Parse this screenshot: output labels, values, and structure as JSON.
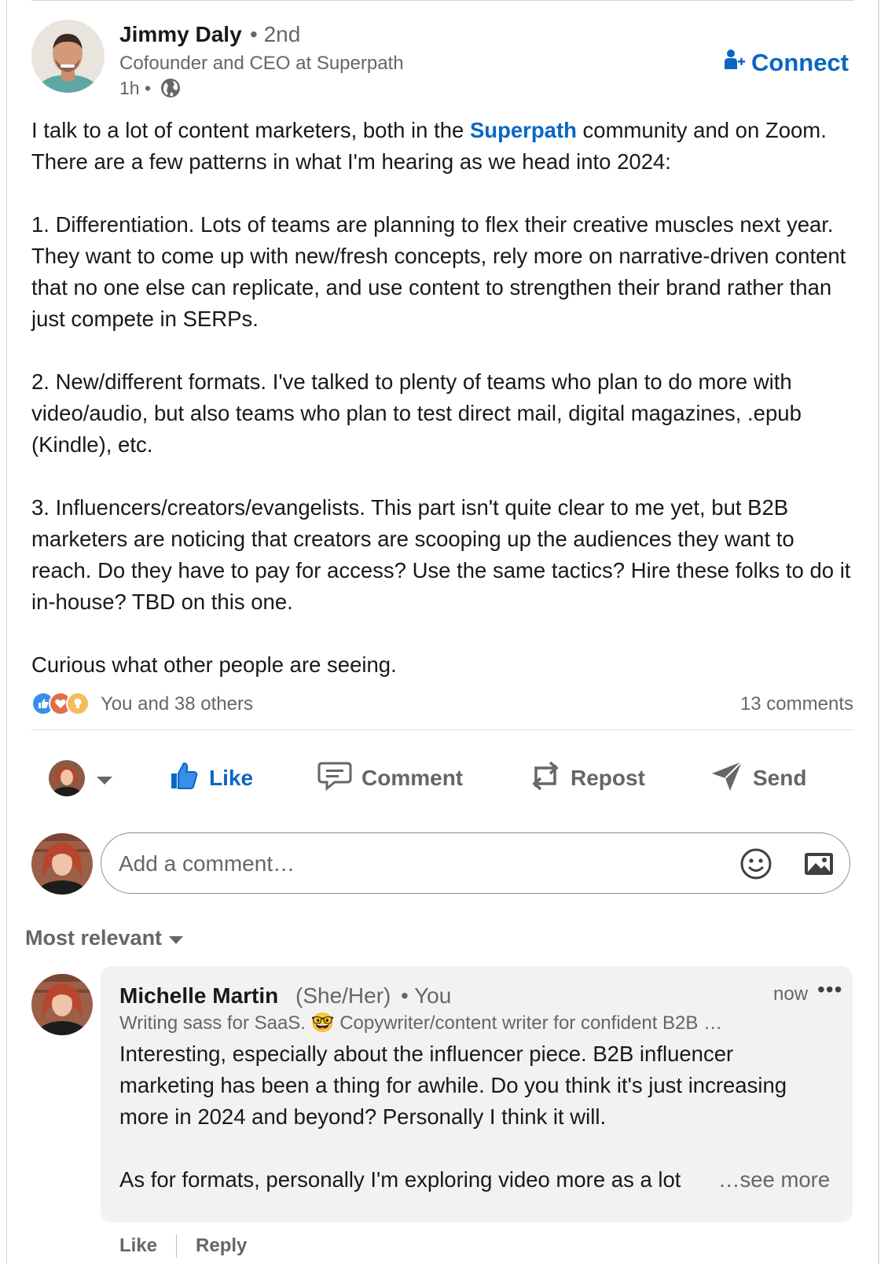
{
  "post": {
    "author": {
      "name": "Jimmy Daly",
      "degree": "• 2nd",
      "headline": "Cofounder and CEO at Superpath",
      "time": "1h •"
    },
    "connect_label": "Connect",
    "body": {
      "p1_pre": "I talk to a lot of content marketers, both in the ",
      "p1_mention": "Superpath",
      "p1_post": " community and on Zoom. There are a few patterns in what I'm hearing as we head into 2024:",
      "p2": "1. Differentiation. Lots of teams are planning to flex their creative muscles next year. They want to come up with new/fresh concepts, rely more on narrative-driven content that no one else can replicate, and use content to strengthen their brand rather than just compete in SERPs.",
      "p3": "2. New/different formats. I've talked to plenty of teams who plan to do more with video/audio, but also teams who plan to test direct mail, digital magazines, .epub (Kindle), etc.",
      "p4": "3. Influencers/creators/evangelists. This part isn't quite clear to me yet, but B2B marketers are noticing that creators are scooping up the audiences they want to reach. Do they have to pay for access? Use the same tactics? Hire these folks to do it in-house? TBD on this one.",
      "p5": "Curious what other people are seeing."
    },
    "reactions": {
      "icons": [
        "like-reaction-icon",
        "love-reaction-icon",
        "insightful-reaction-icon"
      ],
      "count_label": "You and 38 others",
      "comments_label": "13 comments"
    },
    "actions": {
      "like": "Like",
      "comment": "Comment",
      "repost": "Repost",
      "send": "Send"
    },
    "comment_box": {
      "placeholder": "Add a comment…"
    },
    "sort_label": "Most relevant"
  },
  "comment": {
    "name": "Michelle Martin",
    "pronouns": "(She/Her)",
    "you_label": "• You",
    "time": "now",
    "more": "•••",
    "headline": "Writing sass for SaaS. 🤓 Copywriter/content writer for confident B2B …",
    "body_p1": "Interesting, especially about the influencer piece. B2B influencer marketing has been a thing for awhile. Do you think it's just increasing more in 2024 and beyond? Personally I think it will.",
    "body_p2": "As for formats, personally I'm exploring video more as a lot",
    "see_more": "…see more",
    "like": "Like",
    "reply": "Reply"
  },
  "colors": {
    "link_blue": "#0a66c2",
    "text_primary": "#191919",
    "text_secondary": "#666666",
    "comment_bg": "#f2f2f2"
  }
}
